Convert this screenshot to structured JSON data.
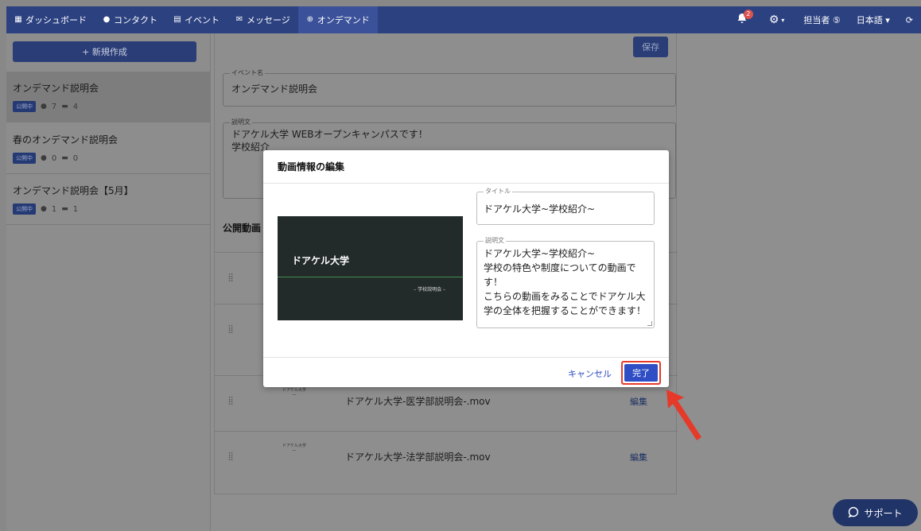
{
  "nav": {
    "items": [
      {
        "icon": "dashboard-icon",
        "glyph": "▦",
        "label": "ダッシュボード"
      },
      {
        "icon": "person-icon",
        "glyph": "●",
        "label": "コンタクト"
      },
      {
        "icon": "calendar-icon",
        "glyph": "▤",
        "label": "イベント"
      },
      {
        "icon": "message-icon",
        "glyph": "✉",
        "label": "メッセージ"
      },
      {
        "icon": "globe-icon",
        "glyph": "⊕",
        "label": "オンデマンド"
      }
    ],
    "notification_count": "2",
    "user_label": "担当者 ⑤",
    "language_label": "日本語 ▾"
  },
  "sidebar": {
    "new_button": "+ 新規作成",
    "events": [
      {
        "title": "オンデマンド説明会",
        "badge": "公開中",
        "people": "7",
        "videos": "4"
      },
      {
        "title": "春のオンデマンド説明会",
        "badge": "公開中",
        "people": "0",
        "videos": "0"
      },
      {
        "title": "オンデマンド説明会【5月】",
        "badge": "公開中",
        "people": "1",
        "videos": "1"
      }
    ]
  },
  "form": {
    "save_label": "保存",
    "event_name_legend": "イベント名",
    "event_name_value": "オンデマンド説明会",
    "description_legend": "説明文",
    "description_line1": "ドアケル大学 WEBオープンキャンパスです！",
    "description_line2": "学校紹介",
    "section_title": "公開動画",
    "videos": [
      {
        "title": "ドアケル大学-医学部説明会-.mov",
        "edit": "編集"
      },
      {
        "title": "ドアケル大学-法学部説明会-.mov",
        "edit": "編集"
      }
    ],
    "thumb_mini_label": "ドアケル大学"
  },
  "modal": {
    "title": "動画情報の編集",
    "thumbnail_title": "ドアケル大学",
    "thumbnail_subtitle": "– 学校説明会 –",
    "title_legend": "タイトル",
    "title_value": "ドアケル大学~学校紹介~",
    "description_legend": "説明文",
    "description_lines": [
      "ドアケル大学~学校紹介~",
      "学校の特色や制度についての動画で",
      "す！",
      "こちらの動画をみることでドアケル大",
      "学の全体を把握することができます！"
    ],
    "cancel_label": "キャンセル",
    "done_label": "完了"
  },
  "support_label": "サポート",
  "colors": {
    "nav": "#2c4180",
    "primary_button": "#2f4ec6",
    "highlight": "#e53a2a"
  }
}
